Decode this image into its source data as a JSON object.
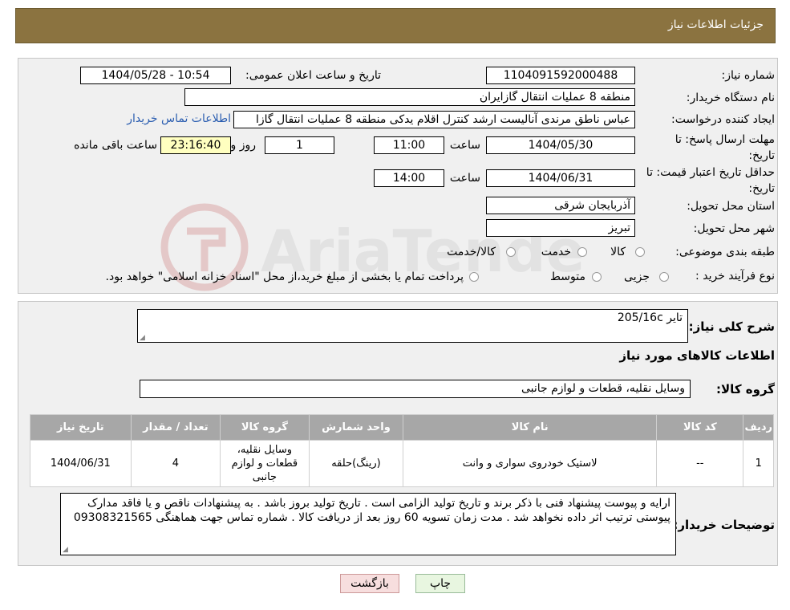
{
  "header": {
    "title": "جزئیات اطلاعات نیاز"
  },
  "form": {
    "need_number_label": "شماره نیاز:",
    "need_number": "1104091592000488",
    "announce_label": "تاریخ و ساعت اعلان عمومی:",
    "announce_value": "1404/05/28 - 10:54",
    "buyer_org_label": "نام دستگاه خریدار:",
    "buyer_org": "منطقه 8 عملیات انتقال گازایران",
    "requester_label": "ایجاد کننده درخواست:",
    "requester": "عباس ناطق مرندی آنالیست ارشد کنترل اقلام یدکی منطقه 8 عملیات انتقال گازا",
    "contact_link": "اطلاعات تماس خریدار",
    "deadline_label": "مهلت ارسال پاسخ: تا تاریخ:",
    "deadline_date": "1404/05/30",
    "time_label": "ساعت",
    "deadline_time": "11:00",
    "days_value": "1",
    "days_label": "روز و",
    "remaining_time": "23:16:40",
    "remaining_label": "ساعت باقی مانده",
    "validity_label": "حداقل تاریخ اعتبار قیمت: تا تاریخ:",
    "validity_date": "1404/06/31",
    "validity_time": "14:00",
    "province_label": "استان محل تحویل:",
    "province": "آذربایجان شرقی",
    "city_label": "شهر محل تحویل:",
    "city": "تبریز",
    "category_label": "طبقه بندی موضوعی:",
    "category_options": [
      "کالا",
      "خدمت",
      "کالا/خدمت"
    ],
    "process_label": "نوع فرآیند خرید :",
    "process_options": [
      "جزیی",
      "متوسط"
    ],
    "process_note": "پرداخت تمام یا بخشی از مبلغ خرید،از محل \"اسناد خزانه اسلامی\" خواهد بود."
  },
  "summary": {
    "desc_label": "شرح کلی نیاز:",
    "desc_value": "تایر 205/16c",
    "goods_info_title": "اطلاعات کالاهای مورد نیاز",
    "group_label": "گروه کالا:",
    "group_value": "وسایل نقلیه، قطعات و لوازم جانبی"
  },
  "table": {
    "headers": [
      "ردیف",
      "کد کالا",
      "نام کالا",
      "واحد شمارش",
      "گروه کالا",
      "تعداد / مقدار",
      "تاریخ نیاز"
    ],
    "rows": [
      [
        "1",
        "--",
        "لاستیک خودروی سواری و وانت",
        "(رینگ)حلقه",
        "وسایل نقلیه، قطعات و لوازم جانبی",
        "4",
        "1404/06/31"
      ]
    ]
  },
  "notes": {
    "label": "توضیحات خریدار:",
    "text": "ارایه و پیوست پیشنهاد فنی با ذکر برند و تاریخ تولید الزامی است . تاریخ تولید بروز باشد . به پیشنهادات ناقص و یا فاقد مدارک پیوستی ترتیب اثر داده نخواهد شد . مدت زمان تسویه 60 روز بعد از دریافت کالا . شماره تماس جهت هماهنگی 09308321565"
  },
  "buttons": {
    "print": "چاپ",
    "back": "بازگشت"
  },
  "watermark_text": "AriaTender.neT"
}
